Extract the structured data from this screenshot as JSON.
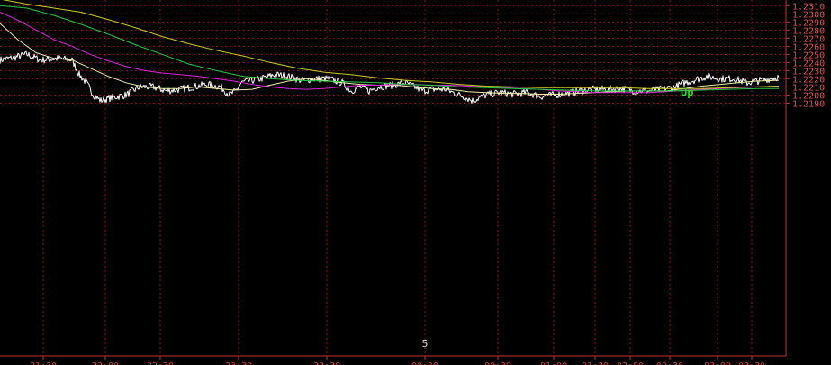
{
  "chart_data": {
    "type": "line",
    "ylim": [
      1.1895,
      1.2317
    ],
    "xlim": [
      0,
      865
    ],
    "grid": true,
    "y_ticks": [
      "1.2310",
      "1.2300",
      "1.2290",
      "1.2280",
      "1.2270",
      "1.2260",
      "1.2250",
      "1.2240",
      "1.2230",
      "1.2220",
      "1.2210",
      "1.2200",
      "1.2190"
    ],
    "y_tick_values": [
      1.231,
      1.23,
      1.229,
      1.228,
      1.227,
      1.226,
      1.225,
      1.224,
      1.223,
      1.222,
      1.221,
      1.22,
      1.219
    ],
    "x_ticks": [
      {
        "label": "21:30",
        "x": 48
      },
      {
        "label": "22:00",
        "x": 117
      },
      {
        "label": "22:30",
        "x": 178
      },
      {
        "label": "23:30",
        "x": 265
      },
      {
        "label": "23:30",
        "x": 363
      },
      {
        "label": "00:00",
        "x": 472
      },
      {
        "label": "00:30",
        "x": 553
      },
      {
        "label": "01:00",
        "x": 615
      },
      {
        "label": "01:30",
        "x": 661
      },
      {
        "label": "02:00",
        "x": 700
      },
      {
        "label": "02:30",
        "x": 744
      },
      {
        "label": "03:00",
        "x": 797
      },
      {
        "label": "03:30",
        "x": 835
      }
    ],
    "marker_text": {
      "label": "5",
      "x": 472
    },
    "annotation": {
      "text": "Up",
      "x": 756,
      "y": 1.2199,
      "color": "#22dd22"
    },
    "series": [
      {
        "color": "#ffffff",
        "width": 1,
        "noise": 0.00045,
        "points": [
          [
            0,
            1.2243
          ],
          [
            15,
            1.2246
          ],
          [
            30,
            1.225
          ],
          [
            45,
            1.2243
          ],
          [
            65,
            1.2245
          ],
          [
            80,
            1.2243
          ],
          [
            88,
            1.2225
          ],
          [
            96,
            1.2215
          ],
          [
            104,
            1.22
          ],
          [
            112,
            1.2193
          ],
          [
            125,
            1.2197
          ],
          [
            140,
            1.22
          ],
          [
            155,
            1.221
          ],
          [
            170,
            1.221
          ],
          [
            185,
            1.2205
          ],
          [
            200,
            1.2207
          ],
          [
            215,
            1.221
          ],
          [
            230,
            1.2213
          ],
          [
            245,
            1.221
          ],
          [
            255,
            1.22
          ],
          [
            262,
            1.2205
          ],
          [
            268,
            1.2215
          ],
          [
            275,
            1.2217
          ],
          [
            290,
            1.222
          ],
          [
            305,
            1.2225
          ],
          [
            320,
            1.2223
          ],
          [
            335,
            1.2218
          ],
          [
            350,
            1.222
          ],
          [
            365,
            1.222
          ],
          [
            380,
            1.2215
          ],
          [
            390,
            1.2205
          ],
          [
            400,
            1.221
          ],
          [
            410,
            1.2205
          ],
          [
            420,
            1.221
          ],
          [
            435,
            1.2212
          ],
          [
            450,
            1.2215
          ],
          [
            460,
            1.221
          ],
          [
            470,
            1.2205
          ],
          [
            480,
            1.2207
          ],
          [
            495,
            1.2207
          ],
          [
            505,
            1.2202
          ],
          [
            515,
            1.2198
          ],
          [
            525,
            1.2193
          ],
          [
            540,
            1.22
          ],
          [
            555,
            1.2203
          ],
          [
            570,
            1.2201
          ],
          [
            585,
            1.2203
          ],
          [
            600,
            1.2198
          ],
          [
            615,
            1.22
          ],
          [
            630,
            1.2202
          ],
          [
            645,
            1.2205
          ],
          [
            660,
            1.2207
          ],
          [
            675,
            1.2207
          ],
          [
            690,
            1.2208
          ],
          [
            705,
            1.2205
          ],
          [
            720,
            1.2205
          ],
          [
            735,
            1.2207
          ],
          [
            750,
            1.221
          ],
          [
            760,
            1.2215
          ],
          [
            770,
            1.2218
          ],
          [
            785,
            1.2223
          ],
          [
            800,
            1.222
          ],
          [
            815,
            1.222
          ],
          [
            830,
            1.2215
          ],
          [
            845,
            1.2218
          ],
          [
            855,
            1.222
          ],
          [
            865,
            1.2222
          ]
        ]
      },
      {
        "color": "#eeeeaa",
        "width": 1,
        "noise": 0,
        "points": [
          [
            0,
            1.2288
          ],
          [
            20,
            1.2268
          ],
          [
            40,
            1.2252
          ],
          [
            60,
            1.2245
          ],
          [
            80,
            1.2243
          ],
          [
            100,
            1.2233
          ],
          [
            120,
            1.2223
          ],
          [
            140,
            1.2215
          ],
          [
            160,
            1.221
          ],
          [
            180,
            1.2208
          ],
          [
            200,
            1.2208
          ],
          [
            220,
            1.221
          ],
          [
            240,
            1.2208
          ],
          [
            260,
            1.2206
          ],
          [
            280,
            1.2207
          ],
          [
            300,
            1.2212
          ],
          [
            320,
            1.2217
          ],
          [
            340,
            1.222
          ],
          [
            360,
            1.2218
          ],
          [
            380,
            1.2215
          ],
          [
            400,
            1.2213
          ],
          [
            420,
            1.2212
          ],
          [
            440,
            1.2212
          ],
          [
            460,
            1.221
          ],
          [
            480,
            1.2208
          ],
          [
            500,
            1.2207
          ],
          [
            520,
            1.2204
          ],
          [
            540,
            1.2203
          ],
          [
            560,
            1.2202
          ],
          [
            580,
            1.2202
          ],
          [
            600,
            1.2201
          ],
          [
            620,
            1.2201
          ],
          [
            640,
            1.2202
          ],
          [
            660,
            1.2203
          ],
          [
            680,
            1.2204
          ],
          [
            700,
            1.2205
          ],
          [
            720,
            1.2205
          ],
          [
            740,
            1.2205
          ],
          [
            760,
            1.2208
          ],
          [
            780,
            1.2211
          ],
          [
            800,
            1.2213
          ],
          [
            820,
            1.2215
          ],
          [
            840,
            1.2217
          ],
          [
            865,
            1.2218
          ]
        ]
      },
      {
        "color": "#dd22dd",
        "width": 1,
        "noise": 0,
        "points": [
          [
            0,
            1.2302
          ],
          [
            20,
            1.2292
          ],
          [
            40,
            1.228
          ],
          [
            60,
            1.2268
          ],
          [
            80,
            1.226
          ],
          [
            100,
            1.225
          ],
          [
            120,
            1.2242
          ],
          [
            140,
            1.2235
          ],
          [
            160,
            1.223
          ],
          [
            180,
            1.2227
          ],
          [
            200,
            1.2225
          ],
          [
            220,
            1.2223
          ],
          [
            240,
            1.222
          ],
          [
            260,
            1.2217
          ],
          [
            280,
            1.2213
          ],
          [
            300,
            1.221
          ],
          [
            320,
            1.2208
          ],
          [
            340,
            1.2207
          ],
          [
            360,
            1.2208
          ],
          [
            380,
            1.221
          ],
          [
            400,
            1.2212
          ],
          [
            420,
            1.2212
          ],
          [
            440,
            1.2213
          ],
          [
            460,
            1.2213
          ],
          [
            480,
            1.2212
          ],
          [
            500,
            1.2212
          ],
          [
            520,
            1.2211
          ],
          [
            540,
            1.221
          ],
          [
            560,
            1.2209
          ],
          [
            580,
            1.2208
          ],
          [
            600,
            1.2207
          ],
          [
            620,
            1.2205
          ],
          [
            640,
            1.2204
          ],
          [
            660,
            1.2203
          ],
          [
            680,
            1.2203
          ],
          [
            700,
            1.2203
          ],
          [
            720,
            1.2203
          ],
          [
            740,
            1.2204
          ],
          [
            760,
            1.2206
          ],
          [
            780,
            1.2207
          ],
          [
            800,
            1.2208
          ],
          [
            820,
            1.2209
          ],
          [
            840,
            1.221
          ],
          [
            865,
            1.2211
          ]
        ]
      },
      {
        "color": "#22cc44",
        "width": 1,
        "noise": 0,
        "points": [
          [
            0,
            1.231
          ],
          [
            30,
            1.2307
          ],
          [
            60,
            1.2298
          ],
          [
            90,
            1.2287
          ],
          [
            120,
            1.2275
          ],
          [
            150,
            1.2262
          ],
          [
            180,
            1.225
          ],
          [
            210,
            1.2238
          ],
          [
            240,
            1.223
          ],
          [
            270,
            1.2223
          ],
          [
            300,
            1.222
          ],
          [
            330,
            1.2218
          ],
          [
            360,
            1.2217
          ],
          [
            390,
            1.2216
          ],
          [
            420,
            1.2215
          ],
          [
            450,
            1.2213
          ],
          [
            480,
            1.2212
          ],
          [
            510,
            1.221
          ],
          [
            540,
            1.2209
          ],
          [
            570,
            1.2208
          ],
          [
            600,
            1.2207
          ],
          [
            630,
            1.2206
          ],
          [
            660,
            1.2205
          ],
          [
            690,
            1.2205
          ],
          [
            720,
            1.2205
          ],
          [
            750,
            1.2205
          ],
          [
            780,
            1.2206
          ],
          [
            810,
            1.2207
          ],
          [
            840,
            1.2208
          ],
          [
            865,
            1.2208
          ]
        ]
      },
      {
        "color": "#cccc22",
        "width": 1,
        "noise": 0,
        "points": [
          [
            0,
            1.2318
          ],
          [
            30,
            1.2312
          ],
          [
            60,
            1.2307
          ],
          [
            90,
            1.2302
          ],
          [
            120,
            1.2293
          ],
          [
            150,
            1.2283
          ],
          [
            180,
            1.2272
          ],
          [
            210,
            1.2263
          ],
          [
            240,
            1.2255
          ],
          [
            270,
            1.2248
          ],
          [
            300,
            1.224
          ],
          [
            330,
            1.2233
          ],
          [
            360,
            1.2228
          ],
          [
            390,
            1.2225
          ],
          [
            420,
            1.2221
          ],
          [
            450,
            1.2218
          ],
          [
            480,
            1.2216
          ],
          [
            510,
            1.2213
          ],
          [
            540,
            1.2211
          ],
          [
            570,
            1.221
          ],
          [
            600,
            1.2209
          ],
          [
            630,
            1.2209
          ],
          [
            660,
            1.2209
          ],
          [
            690,
            1.2209
          ],
          [
            720,
            1.2208
          ],
          [
            750,
            1.2208
          ],
          [
            780,
            1.2208
          ],
          [
            810,
            1.2209
          ],
          [
            840,
            1.221
          ],
          [
            865,
            1.2211
          ]
        ]
      }
    ]
  }
}
